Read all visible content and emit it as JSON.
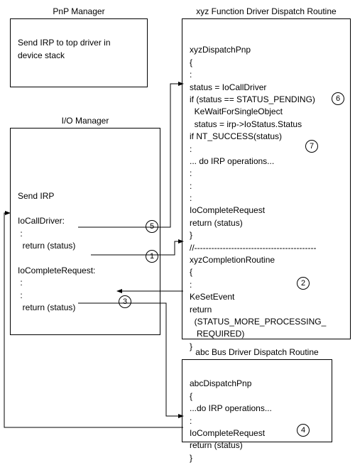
{
  "boxes": {
    "pnp": {
      "title": "PnP Manager",
      "content": "\nSend IRP to top driver in\ndevice stack"
    },
    "io": {
      "title": "I/O Manager",
      "line1": "Send IRP",
      "line2": "IoCallDriver:",
      "line3": " :",
      "line4": "  return (status)",
      "line5": "IoCompleteRequest:",
      "line6": " :",
      "line7": " :",
      "line8": "  return (status)"
    },
    "func": {
      "title": "xyz Function Driver Dispatch Routine",
      "l1": "xyzDispatchPnp",
      "l2": "{",
      "l3": ":",
      "l4": "status = IoCallDriver",
      "l5": "if (status == STATUS_PENDING)",
      "l6": "  KeWaitForSingleObject",
      "l7": "  status = irp->IoStatus.Status",
      "l8": "if NT_SUCCESS(status)",
      "l9": ":",
      "l10": "... do IRP operations...",
      "l11": ":",
      "l12": ":",
      "l13": ":",
      "l14": "IoCompleteRequest",
      "l15": "return (status)",
      "l16": "}",
      "l17": "//-------------------------------------------",
      "l18": "xyzCompletionRoutine",
      "l19": "{",
      "l20": ":",
      "l21": "KeSetEvent",
      "l22": "return",
      "l23": "  (STATUS_MORE_PROCESSING_",
      "l24": "   REQUIRED)",
      "l25": "}"
    },
    "bus": {
      "title": "abc Bus Driver Dispatch Routine",
      "l1": "abcDispatchPnp",
      "l2": "{",
      "l3": "...do IRP operations...",
      "l4": ":",
      "l5": "IoCompleteRequest",
      "l6": "return (status)",
      "l7": "}"
    }
  },
  "steps": {
    "s1": "1",
    "s2": "2",
    "s3": "3",
    "s4": "4",
    "s5": "5",
    "s6": "6",
    "s7": "7"
  }
}
